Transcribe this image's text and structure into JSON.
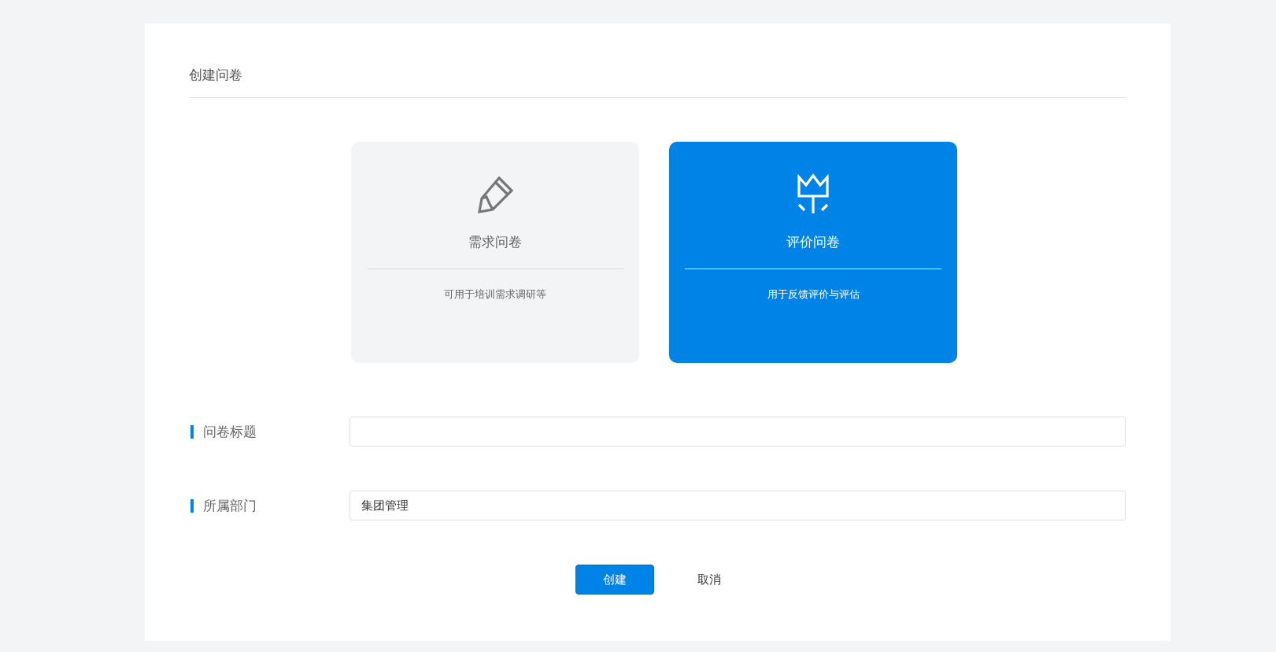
{
  "title": "创建问卷",
  "types": [
    {
      "kind": "pencil",
      "name": "需求问卷",
      "description": "可用于培训需求调研等",
      "selected": false
    },
    {
      "kind": "crown",
      "name": "评价问卷",
      "description": "用于反馈评价与评估",
      "selected": true
    }
  ],
  "fields": [
    {
      "label": "问卷标题"
    },
    {
      "label": "所属部门",
      "value": "集团管理"
    }
  ],
  "buttons": [
    {
      "label": "创建",
      "kind": "primary"
    },
    {
      "label": "取消",
      "kind": "plain"
    }
  ]
}
